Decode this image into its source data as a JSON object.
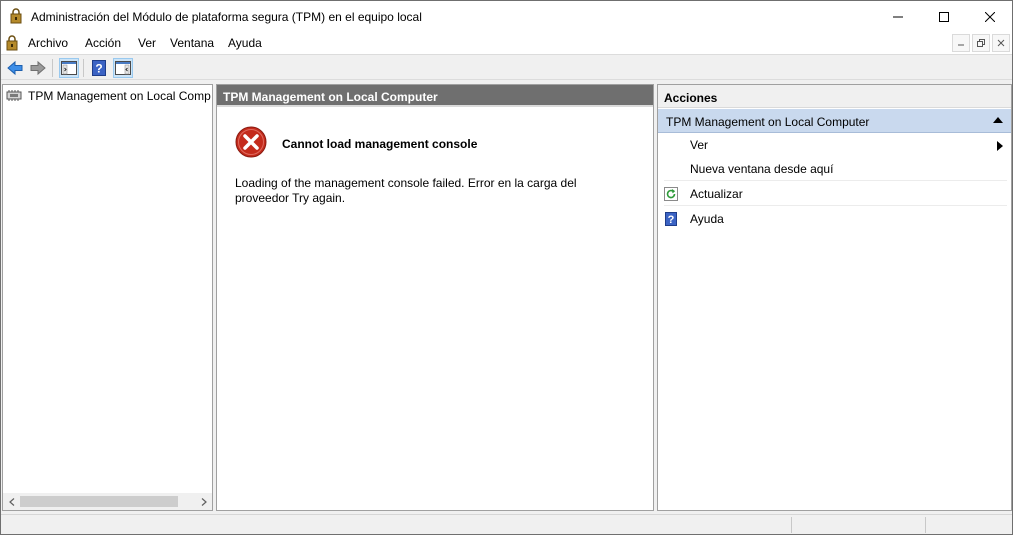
{
  "window": {
    "title": "Administración del Módulo de plataforma segura (TPM) en el equipo local"
  },
  "menu": {
    "items": [
      {
        "label": "Archivo"
      },
      {
        "label": "Acción"
      },
      {
        "label": "Ver"
      },
      {
        "label": "Ventana"
      },
      {
        "label": "Ayuda"
      }
    ]
  },
  "toolbar": {
    "buttons": [
      {
        "icon": "back-arrow-icon"
      },
      {
        "icon": "forward-arrow-icon"
      },
      {
        "icon": "show-hide-console-tree-icon"
      },
      {
        "icon": "help-icon"
      },
      {
        "icon": "show-hide-action-pane-icon"
      }
    ]
  },
  "tree": {
    "root_label": "TPM Management on Local Comp"
  },
  "center": {
    "header": "TPM Management on Local Computer",
    "error_title": "Cannot load management console",
    "error_message": "Loading of the management console failed. Error en la carga del proveedor  Try again."
  },
  "actions": {
    "header": "Acciones",
    "group_label": "TPM Management on Local Computer",
    "items": [
      {
        "label": "Ver",
        "icon": "none",
        "submenu": true
      },
      {
        "label": "Nueva ventana desde aquí",
        "icon": "none"
      },
      {
        "label": "Actualizar",
        "icon": "refresh-icon"
      },
      {
        "label": "Ayuda",
        "icon": "help-icon"
      }
    ]
  },
  "colors": {
    "pane_header_bg": "#6f6f6f",
    "actions_group_bg": "#c9d9ee",
    "error_red": "#c42b1c"
  }
}
